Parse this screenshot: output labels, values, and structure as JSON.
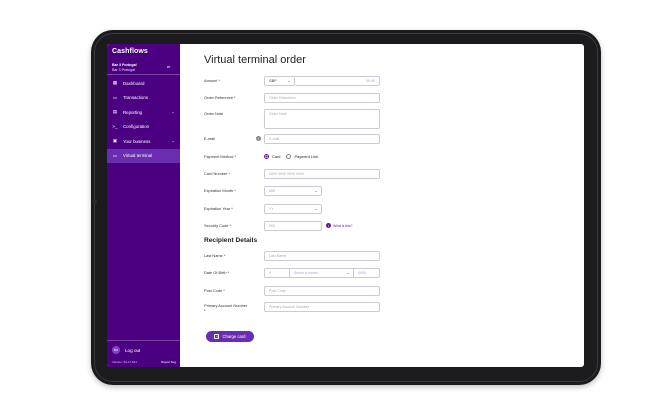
{
  "brand": "Cashflows",
  "account": {
    "name": "Bar 3 Portugal",
    "sub": "Bar 3 Portugal",
    "switch": "⇄"
  },
  "nav": [
    {
      "label": "Dashboard",
      "icon": "dashboard-icon",
      "glyph": "▦"
    },
    {
      "label": "Transactions",
      "icon": "card-icon",
      "glyph": "▭"
    },
    {
      "label": "Reporting",
      "icon": "report-icon",
      "glyph": "▤",
      "chevron": "⌄"
    },
    {
      "label": "Configuration",
      "icon": "terminal-icon",
      "glyph": ">_"
    },
    {
      "label": "Your business",
      "icon": "briefcase-icon",
      "glyph": "▣",
      "chevron": "⌄"
    },
    {
      "label": "Virtual terminal",
      "icon": "terminal-card-icon",
      "glyph": "▭",
      "active": true
    }
  ],
  "logout": {
    "initials": "BO",
    "label": "Log out"
  },
  "footer": {
    "version": "Version: 5a.17.621",
    "report": "Report bug"
  },
  "page_title": "Virtual terminal order",
  "form": {
    "amount": {
      "label": "Amount *",
      "currency": "GBP",
      "value": "00.00"
    },
    "order_reference": {
      "label": "Order Reference *",
      "placeholder": "Order Reference"
    },
    "order_note": {
      "label": "Order Note",
      "placeholder": "Order Note"
    },
    "email": {
      "label": "E-mail",
      "placeholder": "E-mail"
    },
    "payment_method": {
      "label": "Payment Method *",
      "option_card": "Card",
      "option_link": "Payment Link"
    },
    "card_number": {
      "label": "Card Number *",
      "placeholder": "0000 0000 0000 0000"
    },
    "expiration_month": {
      "label": "Expiration Month *",
      "placeholder": "MM"
    },
    "expiration_year": {
      "label": "Expiration Year *",
      "placeholder": "YY"
    },
    "security_code": {
      "label": "Security Code *",
      "placeholder": "000",
      "help": "What is this?"
    }
  },
  "recipient": {
    "title": "Recipient Details",
    "last_name": {
      "label": "Last Name *",
      "placeholder": "Last Name"
    },
    "dob": {
      "label": "Date Of Birth *",
      "day": "0",
      "month": "Select a month",
      "year": "0000"
    },
    "post_code": {
      "label": "Post Code *",
      "placeholder": "Post Code"
    },
    "pan": {
      "label": "Primary Account Number",
      "label2": "*",
      "placeholder": "Primary Account Number"
    }
  },
  "cta": {
    "label": "Charge card",
    "glyph": "+"
  },
  "icons": {
    "chevron": "⌄",
    "info": "i"
  },
  "colors": {
    "brand": "#4b0082",
    "accent": "#6a2db0"
  }
}
